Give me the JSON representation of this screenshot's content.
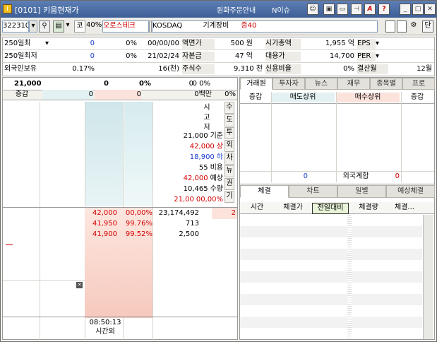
{
  "window": {
    "title": "[0101] 키움현재가",
    "links": [
      "원화주문안내",
      "N이슈"
    ],
    "icons": [
      "user-icon",
      "screen-icon",
      "window-icon",
      "pin-icon",
      "font-icon",
      "help-icon"
    ]
  },
  "toolbar": {
    "code": "322310",
    "ratio_label": "코",
    "ratio": "40%",
    "stock_name": "오로스테크",
    "market": "KOSDAQ",
    "sector": "기계장비",
    "margin": "증40",
    "small_btn": "단"
  },
  "info": {
    "rows": [
      [
        "250일최",
        "0",
        "0%",
        "00/00/00",
        "액면가",
        "500 원",
        "시가총액",
        "1,955 억",
        "EPS"
      ],
      [
        "250일최저",
        "0",
        "0%",
        "21/02/24",
        "자본금",
        "47 억",
        "대용가",
        "14,700",
        "PER"
      ],
      [
        "외국인보유",
        "0.17%",
        "",
        "16(천)",
        "주식수",
        "9,310 천",
        "신용비율",
        "0%",
        "결산월",
        "12월"
      ]
    ]
  },
  "quote": {
    "price": "21,000",
    "change": "0",
    "rate": "0%",
    "volume": "0",
    "vol_rate": "0 0%",
    "sub_label": "증감",
    "sub_val1": "0",
    "sub_val2": "0",
    "sub_val3": "0백만",
    "sub_rate": "0%"
  },
  "center_labels": [
    {
      "label": "시"
    },
    {
      "label": "고"
    },
    {
      "label": "저"
    }
  ],
  "price_info": [
    {
      "v": "21,000",
      "k": "기준",
      "c": "#000"
    },
    {
      "v": "42,000",
      "k": "상",
      "c": "#d40000"
    },
    {
      "v": "18,900",
      "k": "하",
      "c": "#1a3fd2"
    },
    {
      "v": "55",
      "k": "비용",
      "c": "#000"
    },
    {
      "v": "42,000",
      "k": "예상",
      "c": "#d40000"
    },
    {
      "v": "10,465",
      "k": "수량",
      "c": "#000"
    },
    {
      "v": "21,00",
      "k": "00,00%",
      "c": "#d40000"
    }
  ],
  "vtabs": [
    "수",
    "도",
    "투",
    "외",
    "차",
    "뉴",
    "권",
    "기"
  ],
  "bids": [
    {
      "price": "42,000",
      "rate": "00,00%",
      "qty": "23,174,492",
      "extra": "2"
    },
    {
      "price": "41,950",
      "rate": "99.76%",
      "qty": "713",
      "extra": ""
    },
    {
      "price": "41,900",
      "rate": "99.52%",
      "qty": "2,500",
      "extra": ""
    }
  ],
  "time": {
    "clock": "08:50:13",
    "label": "시간외"
  },
  "right_tabs": [
    "거래원",
    "투자자",
    "뉴스",
    "재무",
    "종목별",
    "프로"
  ],
  "broker_header": [
    "증감",
    "매도상위",
    "매수상위",
    "증감"
  ],
  "foreign": {
    "left": "0",
    "label": "외국계합",
    "right": "0"
  },
  "trade_tabs": [
    "체결",
    "차트",
    "일별",
    "예상체결"
  ],
  "trade_header": [
    "시간",
    "체결가",
    "전일대비",
    "체결량",
    "체결..."
  ]
}
